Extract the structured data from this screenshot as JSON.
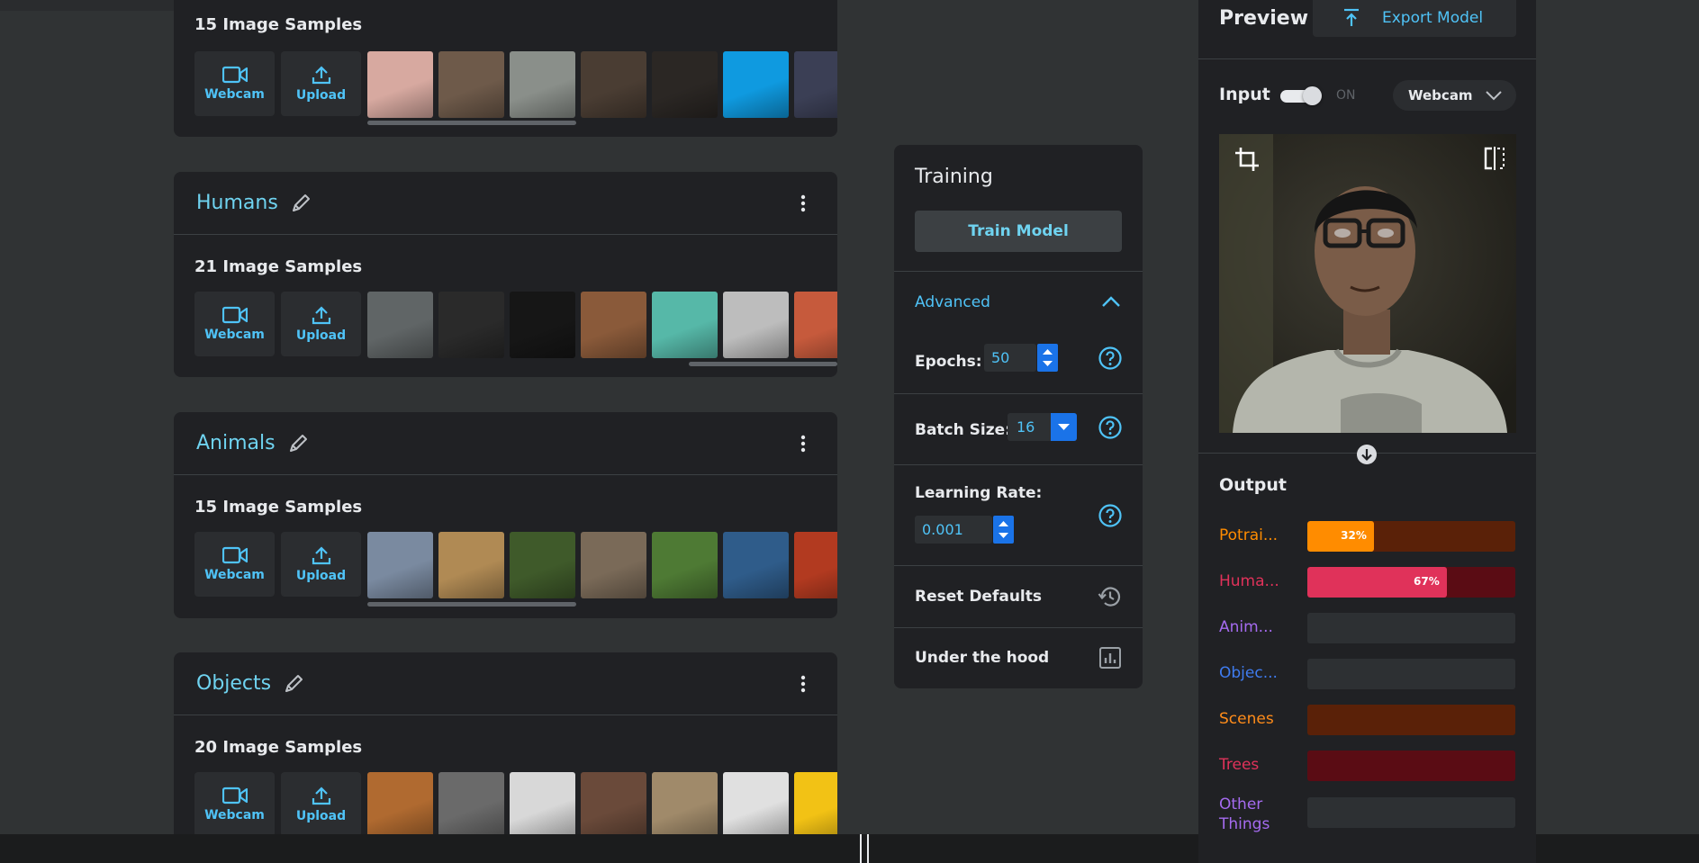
{
  "cards": [
    {
      "title": "",
      "samples_label": "15 Image Samples",
      "webcam_label": "Webcam",
      "upload_label": "Upload",
      "thumb_colors": [
        "#d7a9a0",
        "#6e5a4a",
        "#8a8f8a",
        "#4a3d33",
        "#2b2724",
        "#0f9ae0",
        "#3b3f55"
      ]
    },
    {
      "title": "Humans",
      "samples_label": "21 Image Samples",
      "webcam_label": "Webcam",
      "upload_label": "Upload",
      "thumb_colors": [
        "#606566",
        "#2a2a2a",
        "#161616",
        "#8a5a3a",
        "#56b8a8",
        "#bdbdbd",
        "#c65a3c"
      ]
    },
    {
      "title": "Animals",
      "samples_label": "15 Image Samples",
      "webcam_label": "Webcam",
      "upload_label": "Upload",
      "thumb_colors": [
        "#7a8aa0",
        "#b08a54",
        "#3f5a2a",
        "#7a6a58",
        "#4e7a34",
        "#2f5c8a",
        "#b23a20"
      ]
    },
    {
      "title": "Objects",
      "samples_label": "20 Image Samples",
      "webcam_label": "Webcam",
      "upload_label": "Upload",
      "thumb_colors": [
        "#b06a30",
        "#6a6a6a",
        "#d8d8d8",
        "#6a4a3a",
        "#a08a6a",
        "#e0e0e0",
        "#f2c215"
      ]
    }
  ],
  "training": {
    "title": "Training",
    "train_button": "Train Model",
    "advanced_label": "Advanced",
    "epochs_label": "Epochs:",
    "epochs_value": "50",
    "batch_label": "Batch Size:",
    "batch_value": "16",
    "lr_label": "Learning Rate:",
    "lr_value": "0.001",
    "reset_label": "Reset Defaults",
    "hood_label": "Under the hood"
  },
  "preview": {
    "title": "Preview",
    "export_label": "Export Model",
    "input_label": "Input",
    "toggle_state": "ON",
    "source_select": "Webcam",
    "output_title": "Output",
    "outputs": [
      {
        "label": "Potrai...",
        "color": "#ff8c00",
        "track": "#5a2108",
        "value": 0.32,
        "text": "32%"
      },
      {
        "label": "Huma...",
        "color": "#e0325a",
        "track": "#5a0c14",
        "value": 0.67,
        "text": "67%"
      },
      {
        "label": "Anim...",
        "color": "#a56bf0",
        "track": "#2d3033",
        "value": 0,
        "text": ""
      },
      {
        "label": "Objec...",
        "color": "#3f7cf0",
        "track": "#2d3033",
        "value": 0,
        "text": ""
      },
      {
        "label": "Scenes",
        "color": "#ff8c1a",
        "track": "#5a2108",
        "value": 0,
        "text": ""
      },
      {
        "label": "Trees",
        "color": "#e0325a",
        "track": "#5a0c14",
        "value": 0,
        "text": ""
      },
      {
        "label": "Other Things",
        "color": "#a56bf0",
        "track": "#2d3033",
        "value": 0,
        "text": ""
      }
    ]
  }
}
